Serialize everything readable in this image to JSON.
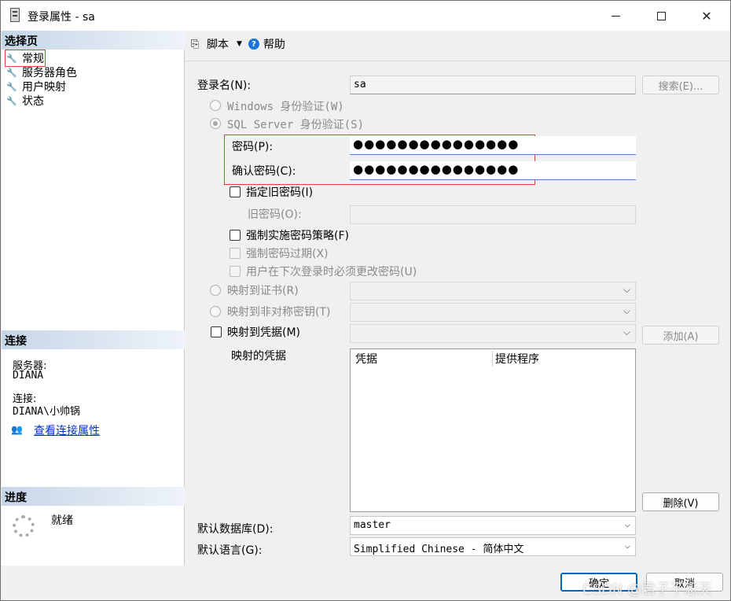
{
  "window": {
    "title": "登录属性 - sa"
  },
  "left_panel": {
    "select_page_header": "选择页",
    "pages": [
      {
        "label": "常规",
        "selected": true
      },
      {
        "label": "服务器角色",
        "selected": false
      },
      {
        "label": "用户映射",
        "selected": false
      },
      {
        "label": "状态",
        "selected": false
      }
    ],
    "connection": {
      "header": "连接",
      "server_label": "服务器:",
      "server_value": "DIANA",
      "connection_label": "连接:",
      "connection_value": "DIANA\\小帅锅",
      "view_link": "查看连接属性"
    },
    "progress": {
      "header": "进度",
      "status": "就绪"
    }
  },
  "toolbar": {
    "script_label": "脚本",
    "help_label": "帮助"
  },
  "form": {
    "login_name_label": "登录名(N):",
    "login_name_value": "sa",
    "search_button": "搜索(E)...",
    "windows_auth_label": "Windows 身份验证(W)",
    "sql_auth_label": "SQL Server 身份验证(S)",
    "password_label": "密码(P):",
    "password_value": "●●●●●●●●●●●●●●●",
    "confirm_password_label": "确认密码(C):",
    "confirm_password_value": "●●●●●●●●●●●●●●●",
    "specify_old_password_label": "指定旧密码(I)",
    "old_password_label": "旧密码(O):",
    "enforce_policy_label": "强制实施密码策略(F)",
    "enforce_expiration_label": "强制密码过期(X)",
    "must_change_label": "用户在下次登录时必须更改密码(U)",
    "map_certificate_label": "映射到证书(R)",
    "map_asymmetric_key_label": "映射到非对称密钥(T)",
    "map_credential_label": "映射到凭据(M)",
    "add_button": "添加(A)",
    "mapped_credentials_label": "映射的凭据",
    "grid_columns": [
      "凭据",
      "提供程序"
    ],
    "remove_button": "删除(V)",
    "default_database_label": "默认数据库(D):",
    "default_database_value": "master",
    "default_language_label": "默认语言(G):",
    "default_language_value": "Simplified Chinese - 简体中文"
  },
  "footer": {
    "ok_button": "确定",
    "cancel_button": "取消",
    "watermark": "CSDN @君子不怨天"
  }
}
